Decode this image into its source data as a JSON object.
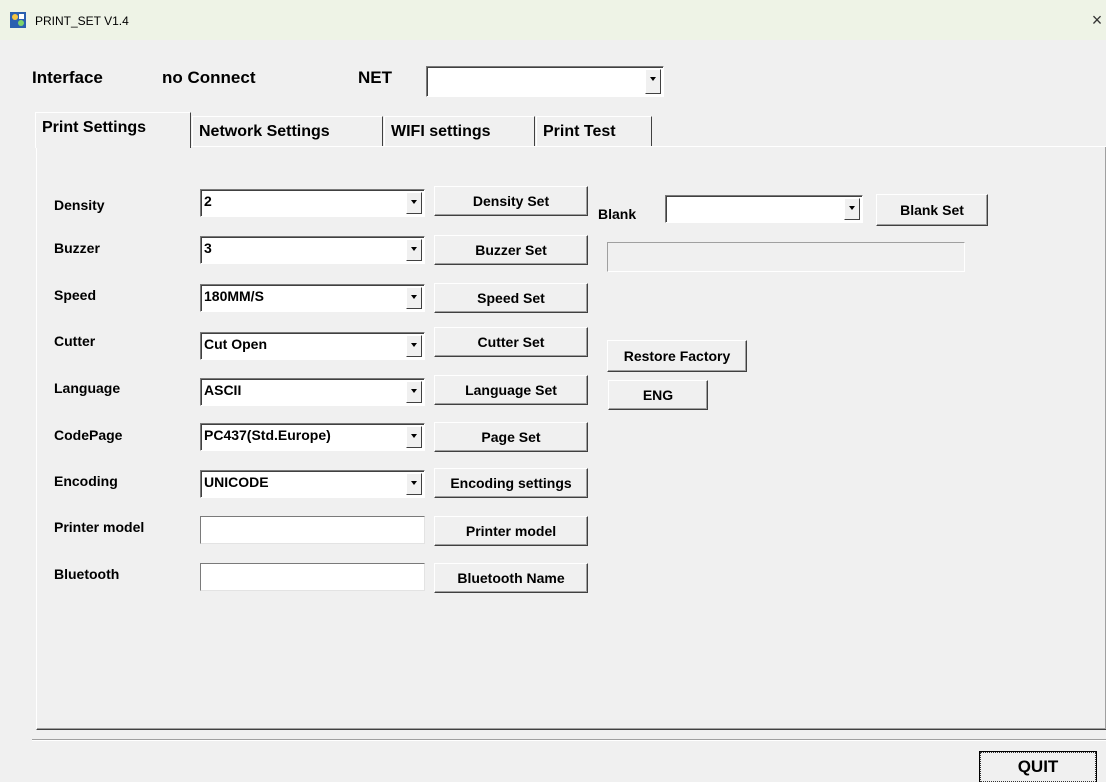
{
  "window": {
    "title": "PRINT_SET V1.4",
    "close_glyph": "×"
  },
  "header": {
    "interface_label": "Interface",
    "connection_status": "no Connect",
    "net_label": "NET",
    "net_value": ""
  },
  "tabs": [
    {
      "label": "Print Settings",
      "active": true
    },
    {
      "label": "Network Settings",
      "active": false
    },
    {
      "label": "WIFI settings",
      "active": false
    },
    {
      "label": "Print Test",
      "active": false
    }
  ],
  "settings": {
    "density": {
      "label": "Density",
      "value": "2",
      "button": "Density Set"
    },
    "buzzer": {
      "label": "Buzzer",
      "value": "3",
      "button": "Buzzer Set"
    },
    "speed": {
      "label": "Speed",
      "value": "180MM/S",
      "button": "Speed Set"
    },
    "cutter": {
      "label": "Cutter",
      "value": "Cut Open",
      "button": "Cutter Set"
    },
    "language": {
      "label": "Language",
      "value": "ASCII",
      "button": "Language Set"
    },
    "codepage": {
      "label": "CodePage",
      "value": "PC437(Std.Europe)",
      "button": "Page Set"
    },
    "encoding": {
      "label": "Encoding",
      "value": "UNICODE",
      "button": "Encoding settings"
    },
    "printer_model": {
      "label": "Printer model",
      "value": "",
      "button": "Printer model"
    },
    "bluetooth": {
      "label": "Bluetooth",
      "value": "",
      "button": "Bluetooth Name"
    }
  },
  "right_panel": {
    "blank_label": "Blank",
    "blank_value": "",
    "blank_button": "Blank Set",
    "status_value": "",
    "restore_button": "Restore Factory",
    "eng_button": "ENG"
  },
  "footer": {
    "quit_button": "QUIT"
  },
  "colors": {
    "titlebar_bg": "#eef3e6",
    "window_bg": "#f0f0f0"
  }
}
